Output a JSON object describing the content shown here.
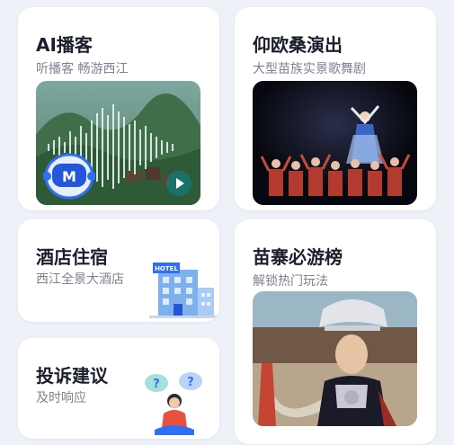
{
  "cards": {
    "ai_podcast": {
      "title": "AI播客",
      "subtitle": "听播客 畅游西江"
    },
    "yang_ou_sang": {
      "title": "仰欧桑演出",
      "subtitle": "大型苗族实景歌舞剧"
    },
    "hotel": {
      "title": "酒店住宿",
      "subtitle": "西江全景大酒店",
      "sign_text": "HOTEL"
    },
    "must_visit": {
      "title": "苗寨必游榜",
      "subtitle": "解锁热门玩法"
    },
    "complaint": {
      "title": "投诉建议",
      "subtitle": "及时响应"
    }
  },
  "icons": {
    "robot": "robot-mascot-icon",
    "play": "play-icon",
    "hotel": "hotel-building-icon",
    "question": "question-person-icon"
  },
  "colors": {
    "background": "#eef1f7",
    "card": "#ffffff",
    "title": "#1b1f2b",
    "subtitle": "#7d8390",
    "accent_blue": "#2f6ff5"
  }
}
